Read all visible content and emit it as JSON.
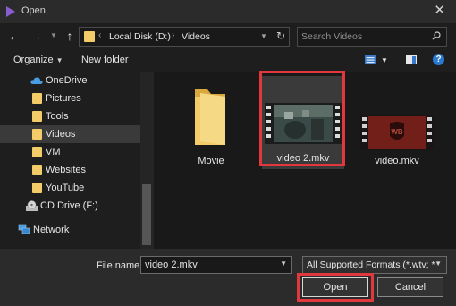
{
  "window": {
    "title": "Open"
  },
  "nav": {
    "path": [
      "Local Disk (D:)",
      "Videos"
    ],
    "search_placeholder": "Search Videos"
  },
  "toolbar": {
    "organize": "Organize",
    "new_folder": "New folder"
  },
  "sidebar": {
    "items": [
      {
        "label": "OneDrive",
        "icon": "cloud-icon"
      },
      {
        "label": "Pictures",
        "icon": "folder-icon"
      },
      {
        "label": "Tools",
        "icon": "folder-icon"
      },
      {
        "label": "Videos",
        "icon": "folder-icon",
        "selected": true
      },
      {
        "label": "VM",
        "icon": "folder-icon"
      },
      {
        "label": "Websites",
        "icon": "folder-icon"
      },
      {
        "label": "YouTube",
        "icon": "folder-icon"
      },
      {
        "label": "CD Drive (F:)",
        "icon": "cd-drive-icon"
      },
      {
        "label": "Network",
        "icon": "network-icon"
      }
    ]
  },
  "files": [
    {
      "name": "Movie",
      "type": "folder"
    },
    {
      "name": "video 2.mkv",
      "type": "video",
      "selected": true
    },
    {
      "name": "video.mkv",
      "type": "video"
    }
  ],
  "footer": {
    "file_name_label": "File name:",
    "file_name_value": "video 2.mkv",
    "filter": "All Supported Formats (*.wtv; *",
    "open_label": "Open",
    "cancel_label": "Cancel"
  },
  "colors": {
    "highlight": "#e0383d",
    "folder": "#f3cc69",
    "help": "#2a7ad3"
  }
}
